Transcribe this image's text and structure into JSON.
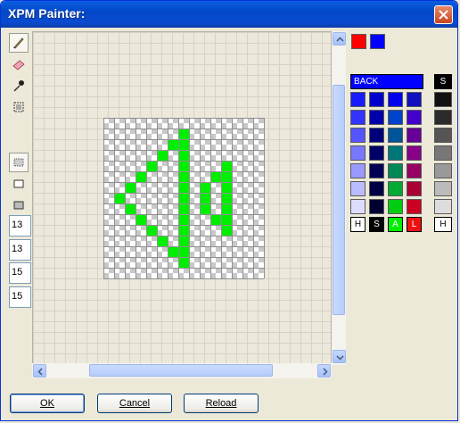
{
  "window": {
    "title": "XPM Painter:"
  },
  "tools": {
    "items": [
      {
        "name": "pencil-tool",
        "icon": "pencil-icon"
      },
      {
        "name": "eraser-tool",
        "icon": "eraser-icon"
      },
      {
        "name": "picker-tool",
        "icon": "eyedropper-icon"
      },
      {
        "name": "select-tool",
        "icon": "selection-icon"
      }
    ],
    "modes": [
      {
        "name": "pattern-fill-mode",
        "icon": "pattern-fill-icon"
      },
      {
        "name": "outline-rect-mode",
        "icon": "outline-rect-icon"
      },
      {
        "name": "filled-rect-mode",
        "icon": "filled-rect-icon"
      }
    ],
    "fields": [
      "13",
      "13",
      "15",
      "15"
    ]
  },
  "colors": {
    "foreground": "#ff0000",
    "background": "#0000ff",
    "accent": "#00ee00",
    "back_label": "BACK",
    "s_label": "S",
    "h_label": "H",
    "bottom_labels": [
      "H",
      "S",
      "A",
      "L"
    ]
  },
  "buttons": {
    "ok": "OK",
    "cancel": "Cancel",
    "reload": "Reload"
  }
}
